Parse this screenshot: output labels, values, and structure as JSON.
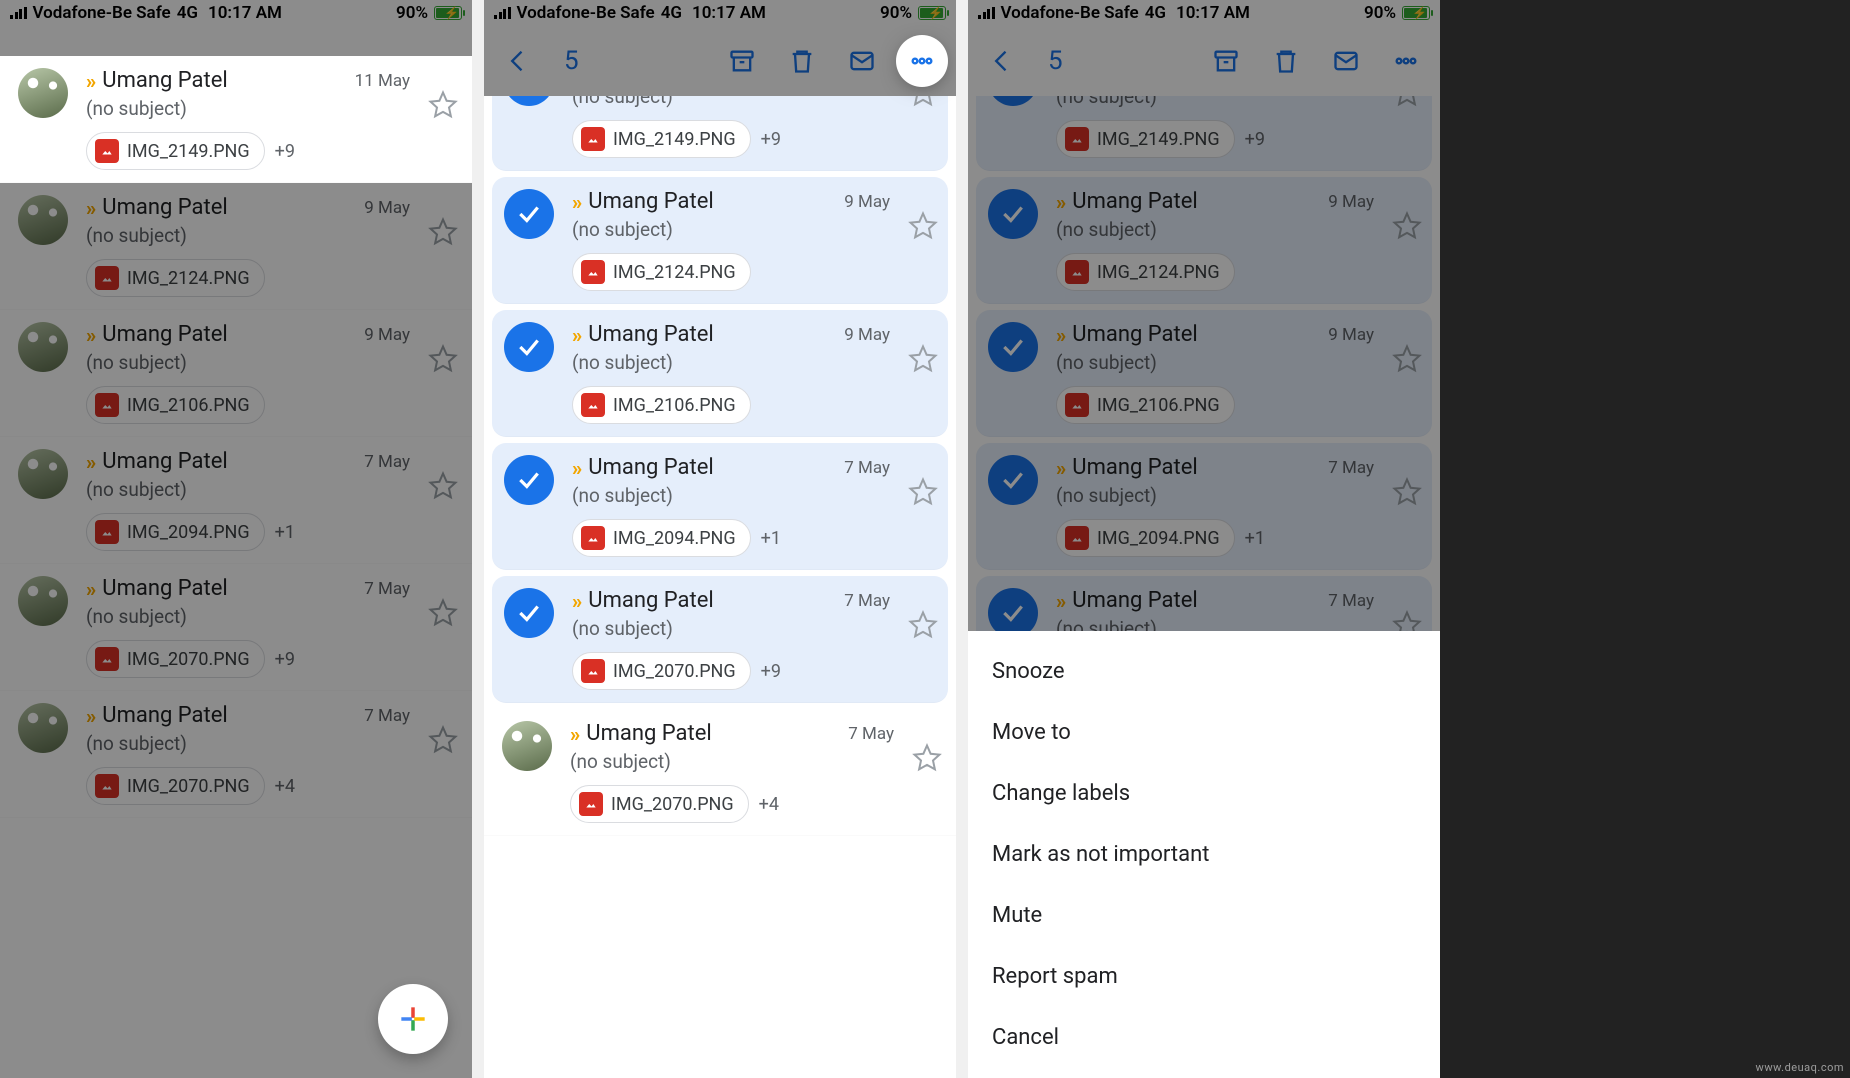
{
  "status": {
    "carrier": "Vodafone-Be Safe",
    "network": "4G",
    "time": "10:17 AM",
    "battery_pct": "90%"
  },
  "selection": {
    "count": "5"
  },
  "emails": [
    {
      "sender": "Umang Patel",
      "subject": "(no subject)",
      "date": "11 May",
      "attachment": "IMG_2149.PNG",
      "extra": "+9"
    },
    {
      "sender": "Umang Patel",
      "subject": "(no subject)",
      "date": "9 May",
      "attachment": "IMG_2124.PNG",
      "extra": ""
    },
    {
      "sender": "Umang Patel",
      "subject": "(no subject)",
      "date": "9 May",
      "attachment": "IMG_2106.PNG",
      "extra": ""
    },
    {
      "sender": "Umang Patel",
      "subject": "(no subject)",
      "date": "7 May",
      "attachment": "IMG_2094.PNG",
      "extra": "+1"
    },
    {
      "sender": "Umang Patel",
      "subject": "(no subject)",
      "date": "7 May",
      "attachment": "IMG_2070.PNG",
      "extra": "+9"
    },
    {
      "sender": "Umang Patel",
      "subject": "(no subject)",
      "date": "7 May",
      "attachment": "IMG_2070.PNG",
      "extra": "+4"
    }
  ],
  "sheet": {
    "items": [
      "Snooze",
      "Move to",
      "Change labels",
      "Mark as not important",
      "Mute",
      "Report spam",
      "Cancel"
    ]
  },
  "watermark": "www.deuaq.com"
}
